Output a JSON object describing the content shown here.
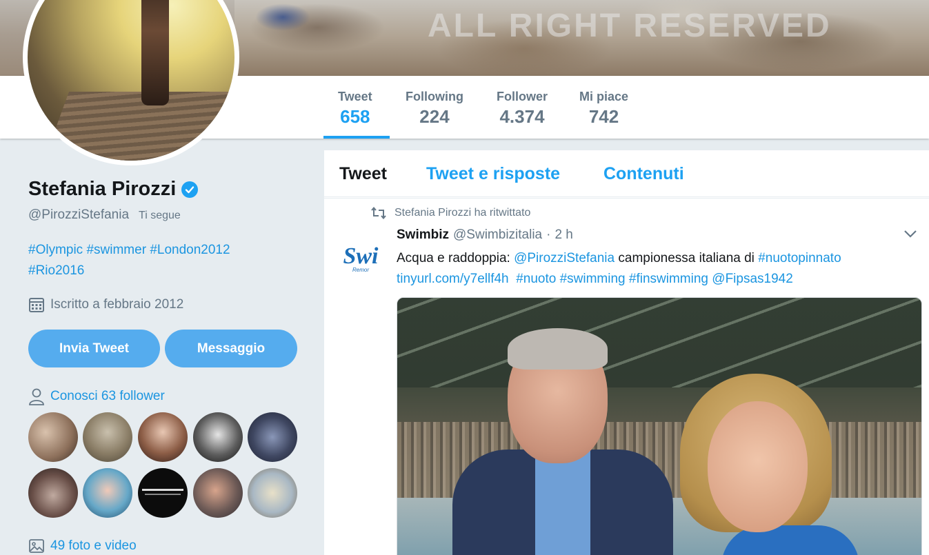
{
  "banner": {
    "watermark": "ALL RIGHT RESERVED"
  },
  "stats": [
    {
      "label": "Tweet",
      "value": "658"
    },
    {
      "label": "Following",
      "value": "224"
    },
    {
      "label": "Follower",
      "value": "4.374"
    },
    {
      "label": "Mi piace",
      "value": "742"
    }
  ],
  "profile": {
    "name": "Stefania Pirozzi",
    "handle": "@PirozziStefania",
    "follows_you": "Ti segue",
    "bio": [
      "#Olympic",
      "#swimmer",
      "#London2012",
      "#Rio2016"
    ],
    "joined": "Iscritto a febbraio 2012",
    "tweet_button": "Invia Tweet",
    "message_button": "Messaggio",
    "know_followers": "Conosci 63 follower",
    "media_link": "49 foto e video"
  },
  "timeline": {
    "tabs": [
      "Tweet",
      "Tweet e risposte",
      "Contenuti"
    ],
    "tweet": {
      "retweeted_by": "Stefania Pirozzi ha ritwittato",
      "author": "Swimbiz",
      "handle": "@Swimbizitalia",
      "separator": "·",
      "time": "2 h",
      "avatar_text": "Swi",
      "avatar_subtext": "Remor",
      "text_prefix": "Acqua e raddoppia: ",
      "mention": "@PirozziStefania",
      "text_middle": " campionessa italiana di ",
      "hashtag1": "#nuotopinnato",
      "url": "tinyurl.com/y7ellf4h",
      "hashtag2": "#nuoto",
      "hashtag3": "#swimming",
      "hashtag4": "#finswimming",
      "mention2": "@Fipsas1942"
    }
  },
  "colors": {
    "accent": "#1da1f2",
    "button": "#55acee",
    "muted": "#657786",
    "background": "#e6ecf0"
  }
}
